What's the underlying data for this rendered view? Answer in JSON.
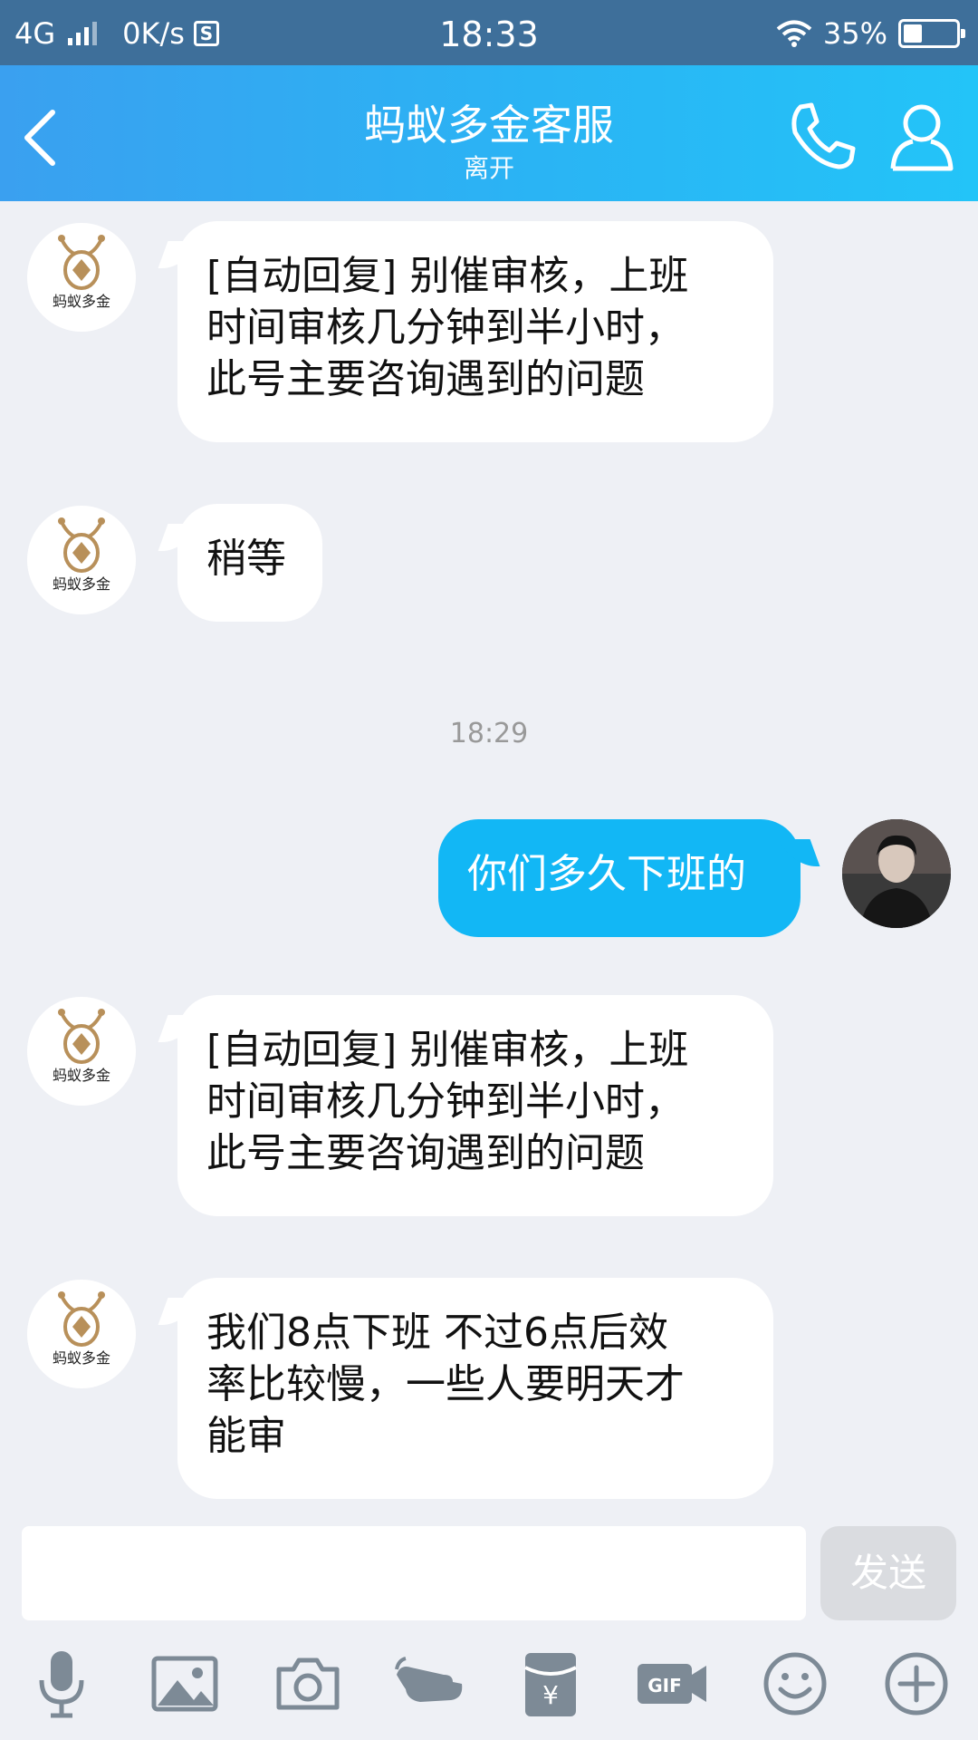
{
  "status_bar": {
    "network": "4G",
    "speed": "0K/s",
    "sim_badge": "S",
    "time": "18:33",
    "battery_percent": "35%",
    "battery_level": 0.35
  },
  "header": {
    "title": "蚂蚁多金客服",
    "status": "离开"
  },
  "messages": [
    {
      "from": "agent",
      "lines": [
        "[自动回复] 别催审核，上班",
        "时间审核几分钟到半小时，",
        "此号主要咨询遇到的问题"
      ]
    },
    {
      "from": "agent",
      "lines": [
        "稍等"
      ]
    },
    {
      "timestamp": "18:29"
    },
    {
      "from": "user",
      "lines": [
        "你们多久下班的"
      ]
    },
    {
      "from": "agent",
      "lines": [
        "[自动回复] 别催审核，上班",
        "时间审核几分钟到半小时，",
        "此号主要咨询遇到的问题"
      ]
    },
    {
      "from": "agent",
      "lines": [
        "我们8点下班  不过6点后效",
        "率比较慢，一些人要明天才",
        "能审"
      ]
    }
  ],
  "agent_logo_text": "蚂蚁多金",
  "input": {
    "value": "",
    "send_label": "发送"
  },
  "toolbar": {
    "gif_label": "GIF",
    "icons": [
      "microphone-icon",
      "image-icon",
      "camera-icon",
      "poke-icon",
      "red-packet-icon",
      "gif-icon",
      "emoji-icon",
      "plus-icon"
    ]
  },
  "colors": {
    "header_start": "#3aa0f0",
    "header_end": "#23c4f8",
    "outgoing_bubble": "#12b7f5",
    "chat_background": "#eef0f5",
    "logo_gold": "#b8905a"
  }
}
